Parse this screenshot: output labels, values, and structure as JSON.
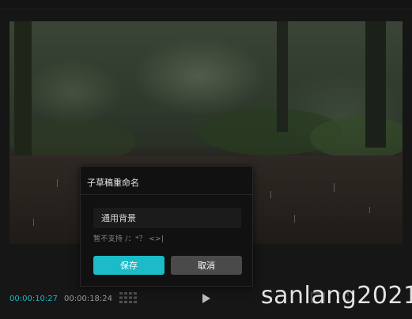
{
  "video": {
    "current_time": "00:00:10:27",
    "total_time": "00:00:18:24"
  },
  "dialog": {
    "title": "子草稿重命名",
    "input_value": "通用背景",
    "hint": "暂不支持 /：*？ <>|",
    "save_label": "保存",
    "cancel_label": "取消"
  },
  "watermark": "sanlang2021",
  "colors": {
    "accent": "#1bbbc7",
    "time_current": "#19b6c6",
    "cancel_bg": "#4a4a4a",
    "dialog_bg": "#111111"
  },
  "icons": [
    "grid-icon",
    "play-icon",
    "fullscreen-icon",
    "ratio-icon"
  ]
}
